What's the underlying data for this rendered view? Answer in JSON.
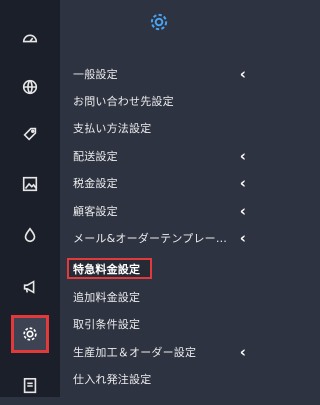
{
  "colors": {
    "rail_bg": "#1b1f29",
    "menu_bg": "#2e3341",
    "accent_blue": "#4aa3f0",
    "highlight_red": "#e23a3a",
    "text": "#ececec"
  },
  "rail": {
    "icons": [
      "dashboard-icon",
      "globe-icon",
      "tag-icon",
      "image-icon",
      "drop-icon",
      "megaphone-icon",
      "gear-icon",
      "document-icon"
    ],
    "active": "gear-icon"
  },
  "menu": {
    "header_icon": "gear-icon",
    "items": [
      {
        "label": "一般設定",
        "has_submenu": true
      },
      {
        "label": "お問い合わせ先設定",
        "has_submenu": false
      },
      {
        "label": "支払い方法設定",
        "has_submenu": false
      },
      {
        "label": "配送設定",
        "has_submenu": true
      },
      {
        "label": "税金設定",
        "has_submenu": true
      },
      {
        "label": "顧客設定",
        "has_submenu": true
      },
      {
        "label": "メール&オーダーテンプレー…",
        "has_submenu": true
      },
      {
        "label": "特急料金設定",
        "has_submenu": false,
        "highlighted": true
      },
      {
        "label": "追加料金設定",
        "has_submenu": false
      },
      {
        "label": "取引条件設定",
        "has_submenu": false
      },
      {
        "label": "生産加工＆オーダー設定",
        "has_submenu": true
      },
      {
        "label": "仕入れ発注設定",
        "has_submenu": false
      }
    ]
  }
}
